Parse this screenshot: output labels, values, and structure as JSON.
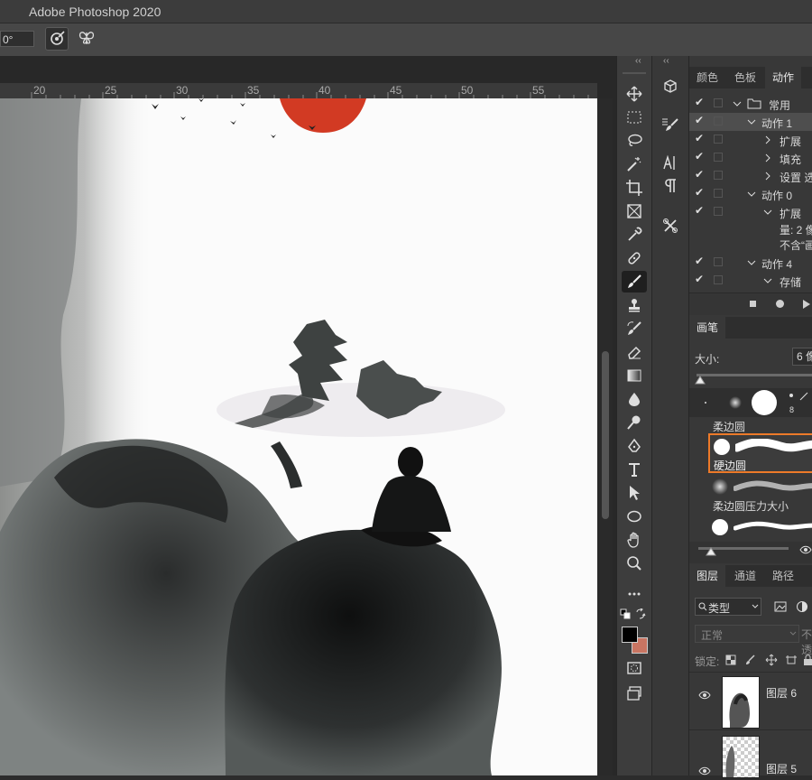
{
  "app": {
    "title": "Adobe Photoshop 2020"
  },
  "options": {
    "angle": "0°"
  },
  "ruler": {
    "ticks": [
      "20",
      "25",
      "30",
      "35",
      "40",
      "45",
      "50",
      "55"
    ]
  },
  "panels_top": {
    "collapse": "‹‹",
    "tabs": [
      "颜色",
      "色板",
      "动作"
    ],
    "actions": [
      {
        "label": "常用",
        "checked": true
      },
      {
        "label": "动作 1",
        "checked": true
      },
      {
        "label": "扩展",
        "checked": true
      },
      {
        "label": "填充",
        "checked": true
      },
      {
        "label": "设置 选",
        "checked": true
      },
      {
        "label": "动作 0",
        "checked": true
      },
      {
        "label": "扩展",
        "checked": true
      },
      {
        "label": "量: 2 像",
        "checked": false
      },
      {
        "label": "不含“画",
        "checked": false
      },
      {
        "label": "动作 4",
        "checked": true
      },
      {
        "label": "存储",
        "checked": true
      }
    ]
  },
  "brush_panel": {
    "tab": "画笔",
    "size_label": "大小:",
    "size_value": "6 像",
    "preset_number": "8",
    "items": [
      "柔边圆",
      "硬边圆",
      "柔边圆压力大小"
    ]
  },
  "layers_panel": {
    "tabs": [
      "图层",
      "通道",
      "路径"
    ],
    "filter_label": "类型",
    "blend_mode": "正常",
    "opacity_label": "不透",
    "lock_label": "锁定:",
    "layers": [
      "图层 6",
      "图层 5"
    ]
  },
  "colors": {
    "foreground": "#000000",
    "background": "#c97562",
    "accent": "#ed7a29"
  }
}
